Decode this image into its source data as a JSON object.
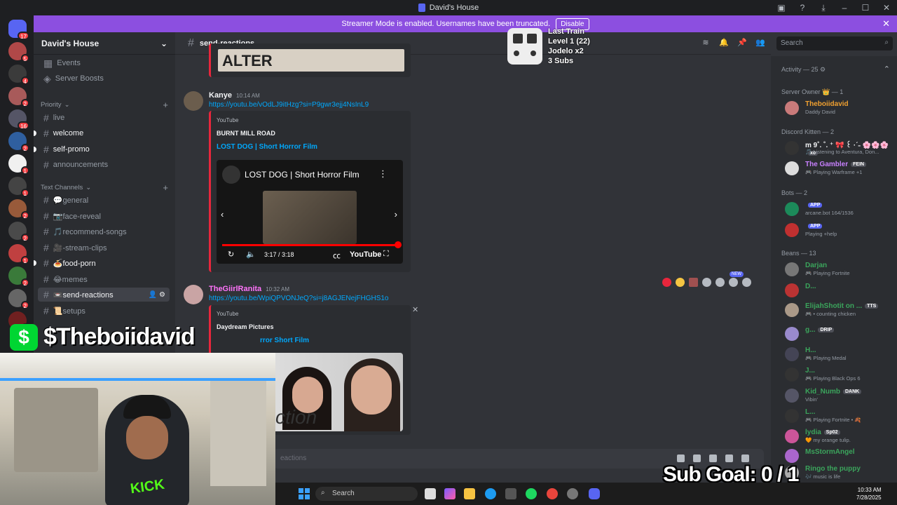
{
  "window": {
    "title": "David's House"
  },
  "banner": {
    "text": "Streamer Mode is enabled. Usernames have been truncated.",
    "button": "Disable"
  },
  "servers": [
    {
      "badge": "17"
    },
    {
      "badge": "5"
    },
    {
      "badge": "4"
    },
    {
      "badge": "2"
    },
    {
      "badge": "16"
    },
    {
      "badge": "2"
    },
    {
      "badge": "1"
    },
    {
      "badge": "1"
    },
    {
      "badge": "2"
    },
    {
      "badge": "2"
    },
    {
      "badge": "1"
    },
    {
      "badge": "2"
    },
    {
      "badge": "2"
    },
    {
      "badge": "1"
    }
  ],
  "sidebar": {
    "guild_name": "David's House",
    "top_items": [
      "Events",
      "Server Boosts"
    ],
    "category_priority": "Priority",
    "category_text": "Text Channels",
    "channels": [
      {
        "name": "live"
      },
      {
        "name": "welcome"
      },
      {
        "name": "self-promo"
      },
      {
        "name": "announcements"
      },
      {
        "name": "💬general"
      },
      {
        "name": "📷face-reveal"
      },
      {
        "name": "🎵recommend-songs"
      },
      {
        "name": "🎥-stream-clips"
      },
      {
        "name": "🍝food-porn"
      },
      {
        "name": "😂memes"
      },
      {
        "name": "📼send-reactions"
      },
      {
        "name": "📜setups"
      }
    ]
  },
  "header": {
    "channel": "send-reactions",
    "search_placeholder": "Search"
  },
  "train": {
    "title": "Last Train",
    "level": "Level 1  (22)",
    "user": "Jodelo x2",
    "subs": "3 Subs"
  },
  "messages": [
    {
      "author": "Kanye",
      "time": "10:14 AM",
      "link": "https://youtu.be/vOdLJ9itHzg?si=P9gwr3ejj4NsInL9",
      "embed": {
        "provider": "YouTube",
        "author": "BURNT MILL ROAD",
        "title": "LOST DOG | Short Horror Film",
        "player_title": "LOST DOG | Short Horror Film",
        "player_time": "3:17 / 3:18",
        "brand": "YouTube"
      }
    },
    {
      "author": "TheGiirlRanita",
      "time": "10:32 AM",
      "link": "https://youtu.be/WpiQPVONJeQ?si=j8AGJENejFHGHS1o",
      "embed": {
        "provider": "YouTube",
        "author": "Daydream Pictures",
        "title": "rror Short Film",
        "image_caption": "ction"
      }
    }
  ],
  "embed_top_label": "ALTER",
  "reaction_new_label": "NEW",
  "composer": {
    "placeholder": "eactions"
  },
  "members": {
    "activity": "Activity — 25 ⚙",
    "sections": [
      {
        "title": "Server Owner 👑 — 1",
        "members": [
          {
            "name": "Theboiidavid",
            "sub": "Daddy David",
            "color": "#f0a030"
          }
        ]
      },
      {
        "title": "Discord Kitten — 2",
        "members": [
          {
            "name": "m 9˚. ˚. ⁺ 🎀 ꒰ ·ˊ˗ 🌸🌸🌸",
            "sub": "🎵 Listening to Aventura, Don...",
            "color": "#f2f3f5",
            "tag": "xo",
            "tagColor": "#4e5058"
          },
          {
            "name": "The Gambler",
            "sub": "🎮 Playing Warframe +1",
            "color": "#c880ff",
            "tag": "FEIN",
            "tagColor": "#4e5058"
          }
        ]
      },
      {
        "title": "Bots — 2",
        "members": [
          {
            "name": "",
            "sub": "arcane.bot 164/1536",
            "color": "#c880ff",
            "tag": "APP",
            "tagColor": "#5865f2"
          },
          {
            "name": "",
            "sub": "Playing +help",
            "color": "#c880ff",
            "tag": "APP",
            "tagColor": "#5865f2"
          }
        ]
      },
      {
        "title": "Beans — 13",
        "members": [
          {
            "name": "Darjan",
            "sub": "🎮 Playing Fortnite",
            "color": "#3ba55c"
          },
          {
            "name": "D...",
            "sub": "",
            "color": "#3ba55c"
          },
          {
            "name": "ElijahShotit on ...",
            "sub": "🎮 • counting chicken",
            "color": "#3ba55c",
            "tag": "TTS",
            "tagColor": "#4e5058"
          },
          {
            "name": "g...",
            "sub": "",
            "color": "#3ba55c",
            "tag": "DRIP",
            "tagColor": "#4e5058"
          },
          {
            "name": "H...",
            "sub": "🎮 Playing Medal",
            "color": "#3ba55c"
          },
          {
            "name": "J...",
            "sub": "🎮 Playing Black Ops 6",
            "color": "#3ba55c"
          },
          {
            "name": "Kid_Numb",
            "sub": "Vibin'",
            "color": "#3ba55c",
            "tag": "DANK",
            "tagColor": "#4e5058"
          },
          {
            "name": "L...",
            "sub": "🎮 Playing Fortnite • 🍂",
            "color": "#3ba55c"
          },
          {
            "name": "lydia",
            "sub": "🧡 my orange tulip.",
            "color": "#3ba55c",
            "tag": "Sp02",
            "tagColor": "#4e5058"
          },
          {
            "name": "MsStormAngel",
            "sub": "",
            "color": "#3ba55c"
          },
          {
            "name": "Ringo the puppy",
            "sub": "🎶 music is life",
            "color": "#3ba55c"
          }
        ]
      }
    ]
  },
  "overlay": {
    "cashtag": "$Theboiidavid",
    "sub_goal": "Sub Goal:  0 / 1",
    "kick": "KICK"
  },
  "taskbar": {
    "search": "Search",
    "time": "10:33 AM",
    "date": "7/28/2025"
  },
  "colors": {
    "accent": "#5865f2",
    "banner": "#8c4fe0",
    "cashapp": "#00d632",
    "kick": "#53fc18"
  }
}
